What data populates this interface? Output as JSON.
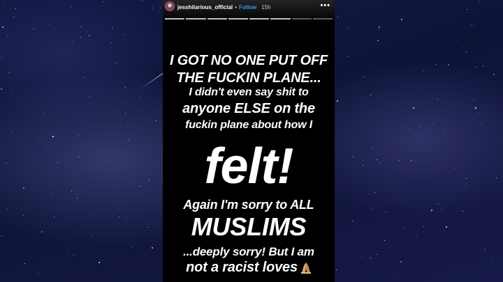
{
  "story": {
    "username": "jesshilarious_official",
    "separator": "•",
    "follow_label": "Follow",
    "time": "15h",
    "more_icon": "more-dots-icon",
    "lines": [
      "I GOT NO ONE PUT OFF",
      "THE FUCKIN PLANE...",
      "I didn't even say shit to",
      "anyone ELSE on the",
      "fuckin plane about how I",
      "felt!",
      "Again I'm sorry to ALL",
      "MUSLIMS",
      "...deeply sorry! But I am",
      "not a racist loves"
    ],
    "emoji": "praying-hands-icon"
  },
  "colors": {
    "follow": "#3897f0",
    "story_background": "#000000",
    "text": "#ffffff"
  }
}
